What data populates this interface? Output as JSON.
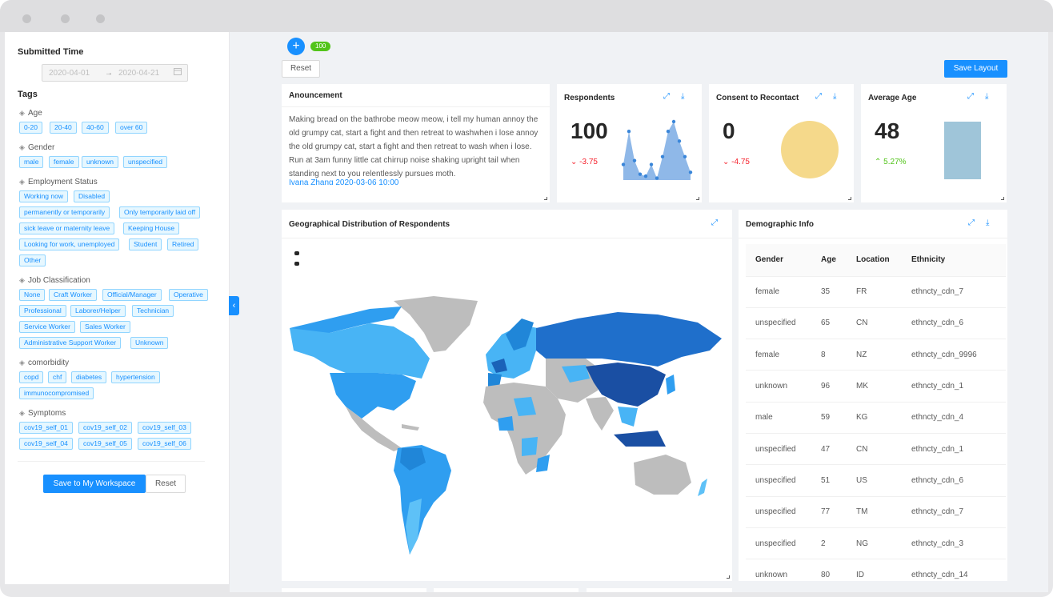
{
  "sidebar": {
    "submitted_time_label": "Submitted Time",
    "date_start": "2020-04-01",
    "date_end": "2020-04-21",
    "tags_label": "Tags",
    "groups": {
      "age": {
        "label": "Age",
        "tags": [
          "0-20",
          "20-40",
          "40-60",
          "over 60"
        ]
      },
      "gender": {
        "label": "Gender",
        "tags": [
          "male",
          "female",
          "unknown",
          "unspecified"
        ]
      },
      "employment": {
        "label": "Employment Status",
        "tags": [
          "Working now",
          "Disabled",
          "permanently or temporarily",
          "Only temporarily laid off",
          "sick leave or maternity leave",
          "Keeping House",
          "Looking for work, unemployed",
          "Student",
          "Retired",
          "Other"
        ]
      },
      "job": {
        "label": "Job Classification",
        "tags": [
          "None",
          "Craft Worker",
          "Official/Manager",
          "Operative",
          "Professional",
          "Laborer/Helper",
          "Technician",
          "Service Worker",
          "Sales Worker",
          "Administrative Support Worker",
          "Unknown"
        ]
      },
      "comorbidity": {
        "label": "comorbidity",
        "tags": [
          "copd",
          "chf",
          "diabetes",
          "hypertension",
          "immunocompromised"
        ]
      },
      "symptoms": {
        "label": "Symptoms",
        "tags": [
          "cov19_self_01",
          "cov19_self_02",
          "cov19_self_03",
          "cov19_self_04",
          "cov19_self_05",
          "cov19_self_06"
        ]
      }
    },
    "save_button": "Save to My Workspace",
    "reset_button": "Reset"
  },
  "toolbar": {
    "badge_count": "100",
    "reset_button": "Reset",
    "save_layout_button": "Save Layout"
  },
  "announcement": {
    "title": "Anouncement",
    "text": "Making bread on the bathrobe meow meow, i tell my human annoy the old grumpy cat, start a fight and then retreat to washwhen i lose annoy the old grumpy cat, start a fight and then retreat to wash when i lose. Run at 3am funny little cat chirrup noise shaking upright tail when standing next to you relentlessly pursues moth.",
    "author_date": "Ivana Zhang 2020-03-06 10:00"
  },
  "respondents": {
    "title": "Respondents",
    "value": "100",
    "delta": "-3.75"
  },
  "consent": {
    "title": "Consent to Recontact",
    "value": "0",
    "delta": "-4.75"
  },
  "average_age": {
    "title": "Average Age",
    "value": "48",
    "delta": "5.27%"
  },
  "geo": {
    "title": "Geographical Distribution of Respondents"
  },
  "demographic": {
    "title": "Demographic Info",
    "columns": [
      "Gender",
      "Age",
      "Location",
      "Ethnicity"
    ],
    "rows": [
      [
        "female",
        "35",
        "FR",
        "ethncty_cdn_7"
      ],
      [
        "unspecified",
        "65",
        "CN",
        "ethncty_cdn_6"
      ],
      [
        "female",
        "8",
        "NZ",
        "ethncty_cdn_9996"
      ],
      [
        "unknown",
        "96",
        "MK",
        "ethncty_cdn_1"
      ],
      [
        "male",
        "59",
        "KG",
        "ethncty_cdn_4"
      ],
      [
        "unspecified",
        "47",
        "CN",
        "ethncty_cdn_1"
      ],
      [
        "unspecified",
        "51",
        "US",
        "ethncty_cdn_6"
      ],
      [
        "unspecified",
        "77",
        "TM",
        "ethncty_cdn_7"
      ],
      [
        "unspecified",
        "2",
        "NG",
        "ethncty_cdn_3"
      ],
      [
        "unknown",
        "80",
        "ID",
        "ethncty_cdn_14"
      ]
    ]
  },
  "colors": {
    "primary": "#1890ff",
    "negative": "#f5222d",
    "positive": "#52c41a",
    "badge": "#52c41a",
    "pie": "#f5d98b",
    "bar": "#9fc5d9",
    "area": "#8fb8e8"
  },
  "chart_data": [
    {
      "type": "area",
      "title": "Respondents",
      "values": [
        8,
        25,
        10,
        3,
        2,
        8,
        1,
        12,
        25,
        30,
        20,
        12,
        4
      ]
    },
    {
      "type": "pie",
      "title": "Consent to Recontact",
      "values": [
        1
      ]
    },
    {
      "type": "bar",
      "title": "Average Age",
      "values": [
        48
      ]
    }
  ]
}
